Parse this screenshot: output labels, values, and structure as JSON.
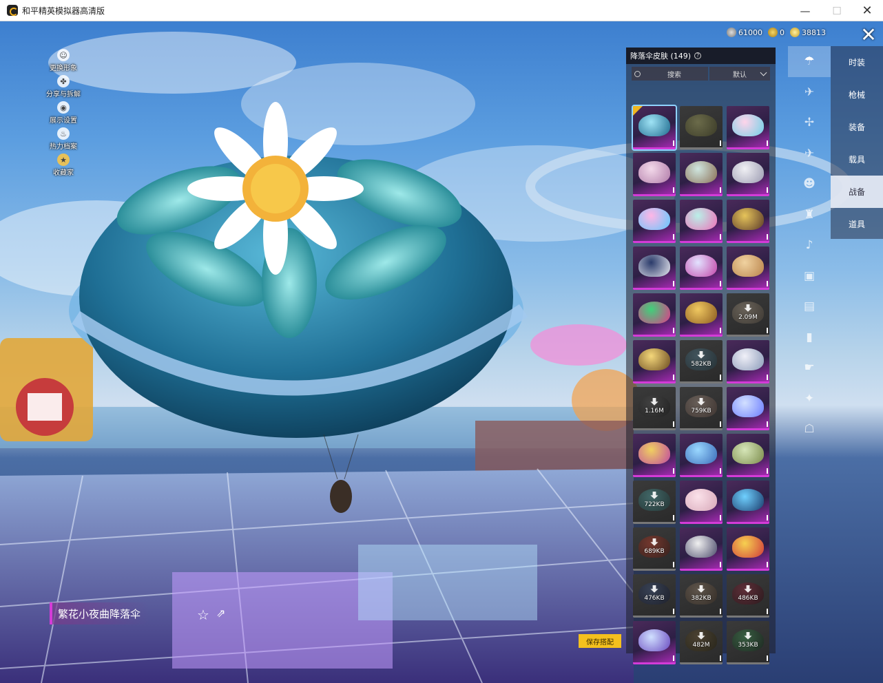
{
  "window": {
    "title": "和平精英模拟器高清版",
    "min_glyph": "—",
    "max_glyph": "☐",
    "close_glyph": "✕"
  },
  "currency": {
    "silver": "61000",
    "gold_token": "0",
    "coupon": "38813"
  },
  "left_menu": [
    {
      "label": "更换形象",
      "icon": "avatar-icon",
      "glyph": "☺"
    },
    {
      "label": "分享与拆解",
      "icon": "share-split-icon",
      "glyph": "✤"
    },
    {
      "label": "展示设置",
      "icon": "eye-icon",
      "glyph": "◉"
    },
    {
      "label": "热力档案",
      "icon": "flame-icon",
      "glyph": "♨"
    },
    {
      "label": "收藏家",
      "icon": "collector-badge-icon",
      "glyph": "★"
    }
  ],
  "panel": {
    "title": "降落伞皮肤 (149)",
    "help_glyph": "?",
    "search_label": "搜索",
    "sort_label": "默认"
  },
  "skins": [
    {
      "type": "owned",
      "selected": true,
      "colors": [
        "#9fe3f5",
        "#1e6a8e"
      ]
    },
    {
      "type": "owned",
      "dark": true,
      "colors": [
        "#6b6b4a",
        "#3b3b28"
      ]
    },
    {
      "type": "owned",
      "colors": [
        "#ffd4ea",
        "#6fd0e7"
      ]
    },
    {
      "type": "owned",
      "colors": [
        "#f3d9ea",
        "#b07ba8"
      ]
    },
    {
      "type": "owned",
      "colors": [
        "#cfe6e0",
        "#8a6f55"
      ]
    },
    {
      "type": "owned",
      "colors": [
        "#f0f0f4",
        "#9a9ab0"
      ]
    },
    {
      "type": "owned",
      "colors": [
        "#ffb6e6",
        "#5fc8ff"
      ]
    },
    {
      "type": "owned",
      "colors": [
        "#b9f0e8",
        "#ee70b8"
      ]
    },
    {
      "type": "owned",
      "colors": [
        "#e6c45a",
        "#5a3a2a"
      ]
    },
    {
      "type": "owned",
      "colors": [
        "#2a3a6a",
        "#e8e8f0"
      ]
    },
    {
      "type": "owned",
      "colors": [
        "#e2e2ff",
        "#c244a8"
      ]
    },
    {
      "type": "owned",
      "colors": [
        "#f0d2a0",
        "#b8824a"
      ]
    },
    {
      "type": "owned",
      "colors": [
        "#3fd17a",
        "#e03a8a"
      ]
    },
    {
      "type": "owned",
      "colors": [
        "#f0c860",
        "#8a5a20"
      ]
    },
    {
      "type": "download",
      "size": "2.09M",
      "dark": true,
      "colors": [
        "#8a7f70",
        "#4a4238"
      ]
    },
    {
      "type": "owned",
      "colors": [
        "#f4d77a",
        "#6a4a20"
      ]
    },
    {
      "type": "download",
      "size": "582KB",
      "dark": true,
      "colors": [
        "#4a6a78",
        "#22343c"
      ]
    },
    {
      "type": "owned",
      "colors": [
        "#f0f0f8",
        "#8a9ab8"
      ]
    },
    {
      "type": "download",
      "size": "1.16M",
      "dark": true,
      "colors": [
        "#4a4a4a",
        "#1a1a1a"
      ]
    },
    {
      "type": "download",
      "size": "759KB",
      "dark": true,
      "colors": [
        "#8a7a70",
        "#4a3a34"
      ]
    },
    {
      "type": "owned",
      "colors": [
        "#d2e0ff",
        "#6a7bff"
      ]
    },
    {
      "type": "owned",
      "colors": [
        "#f0d060",
        "#c04aa0"
      ]
    },
    {
      "type": "owned",
      "colors": [
        "#9ad8ff",
        "#3a6ab8"
      ]
    },
    {
      "type": "owned",
      "colors": [
        "#d6e6b8",
        "#7a8a4a"
      ]
    },
    {
      "type": "download",
      "size": "722KB",
      "dark": true,
      "colors": [
        "#4a8a8a",
        "#1f3a3a"
      ]
    },
    {
      "type": "owned",
      "colors": [
        "#fbe2ea",
        "#d7a7b8"
      ]
    },
    {
      "type": "owned",
      "colors": [
        "#6fd0ff",
        "#1a3a6a"
      ]
    },
    {
      "type": "download",
      "size": "689KB",
      "dark": true,
      "colors": [
        "#a03a2a",
        "#3a1a14"
      ]
    },
    {
      "type": "owned",
      "colors": [
        "#f0f0f0",
        "#4a4a6a"
      ]
    },
    {
      "type": "owned",
      "colors": [
        "#f6d050",
        "#d03a3a"
      ]
    },
    {
      "type": "download",
      "size": "476KB",
      "dark": true,
      "colors": [
        "#3a4a6a",
        "#14182a"
      ]
    },
    {
      "type": "download",
      "size": "382KB",
      "dark": true,
      "colors": [
        "#7a6a5a",
        "#3a2e24"
      ]
    },
    {
      "type": "download",
      "size": "486KB",
      "dark": true,
      "colors": [
        "#7a2a3a",
        "#2a0e14"
      ]
    },
    {
      "type": "owned",
      "colors": [
        "#d0e0ff",
        "#6a4ac0"
      ]
    },
    {
      "type": "download",
      "size": "482M",
      "dark": true,
      "colors": [
        "#5a4a30",
        "#24200e"
      ]
    },
    {
      "type": "download",
      "size": "353KB",
      "dark": true,
      "colors": [
        "#3a7a4a",
        "#14241a"
      ]
    }
  ],
  "category_tabs": [
    "时装",
    "枪械",
    "装备",
    "载具",
    "战备",
    "道具"
  ],
  "active_category": 4,
  "icon_column": [
    {
      "name": "parachute-icon",
      "glyph": "☂"
    },
    {
      "name": "airplane-trail-icon",
      "glyph": "✈"
    },
    {
      "name": "drone-icon",
      "glyph": "✢"
    },
    {
      "name": "plane-icon",
      "glyph": "✈"
    },
    {
      "name": "emote-icon",
      "glyph": "☻"
    },
    {
      "name": "robot-icon",
      "glyph": "♜"
    },
    {
      "name": "speaker-icon",
      "glyph": "♪"
    },
    {
      "name": "companion-icon",
      "glyph": "▣"
    },
    {
      "name": "frame-icon",
      "glyph": "▤"
    },
    {
      "name": "bottle-icon",
      "glyph": "▮"
    },
    {
      "name": "hand-icon",
      "glyph": "☛"
    },
    {
      "name": "sparkle-icon",
      "glyph": "✦"
    },
    {
      "name": "hat-icon",
      "glyph": "☖"
    }
  ],
  "item_name": "繁花小夜曲降落伞",
  "save_label": "保存搭配",
  "colors": {
    "accent_pink": "#d43bd8",
    "save_yellow": "#f4c01e",
    "select_gold": "#f1b61f"
  }
}
